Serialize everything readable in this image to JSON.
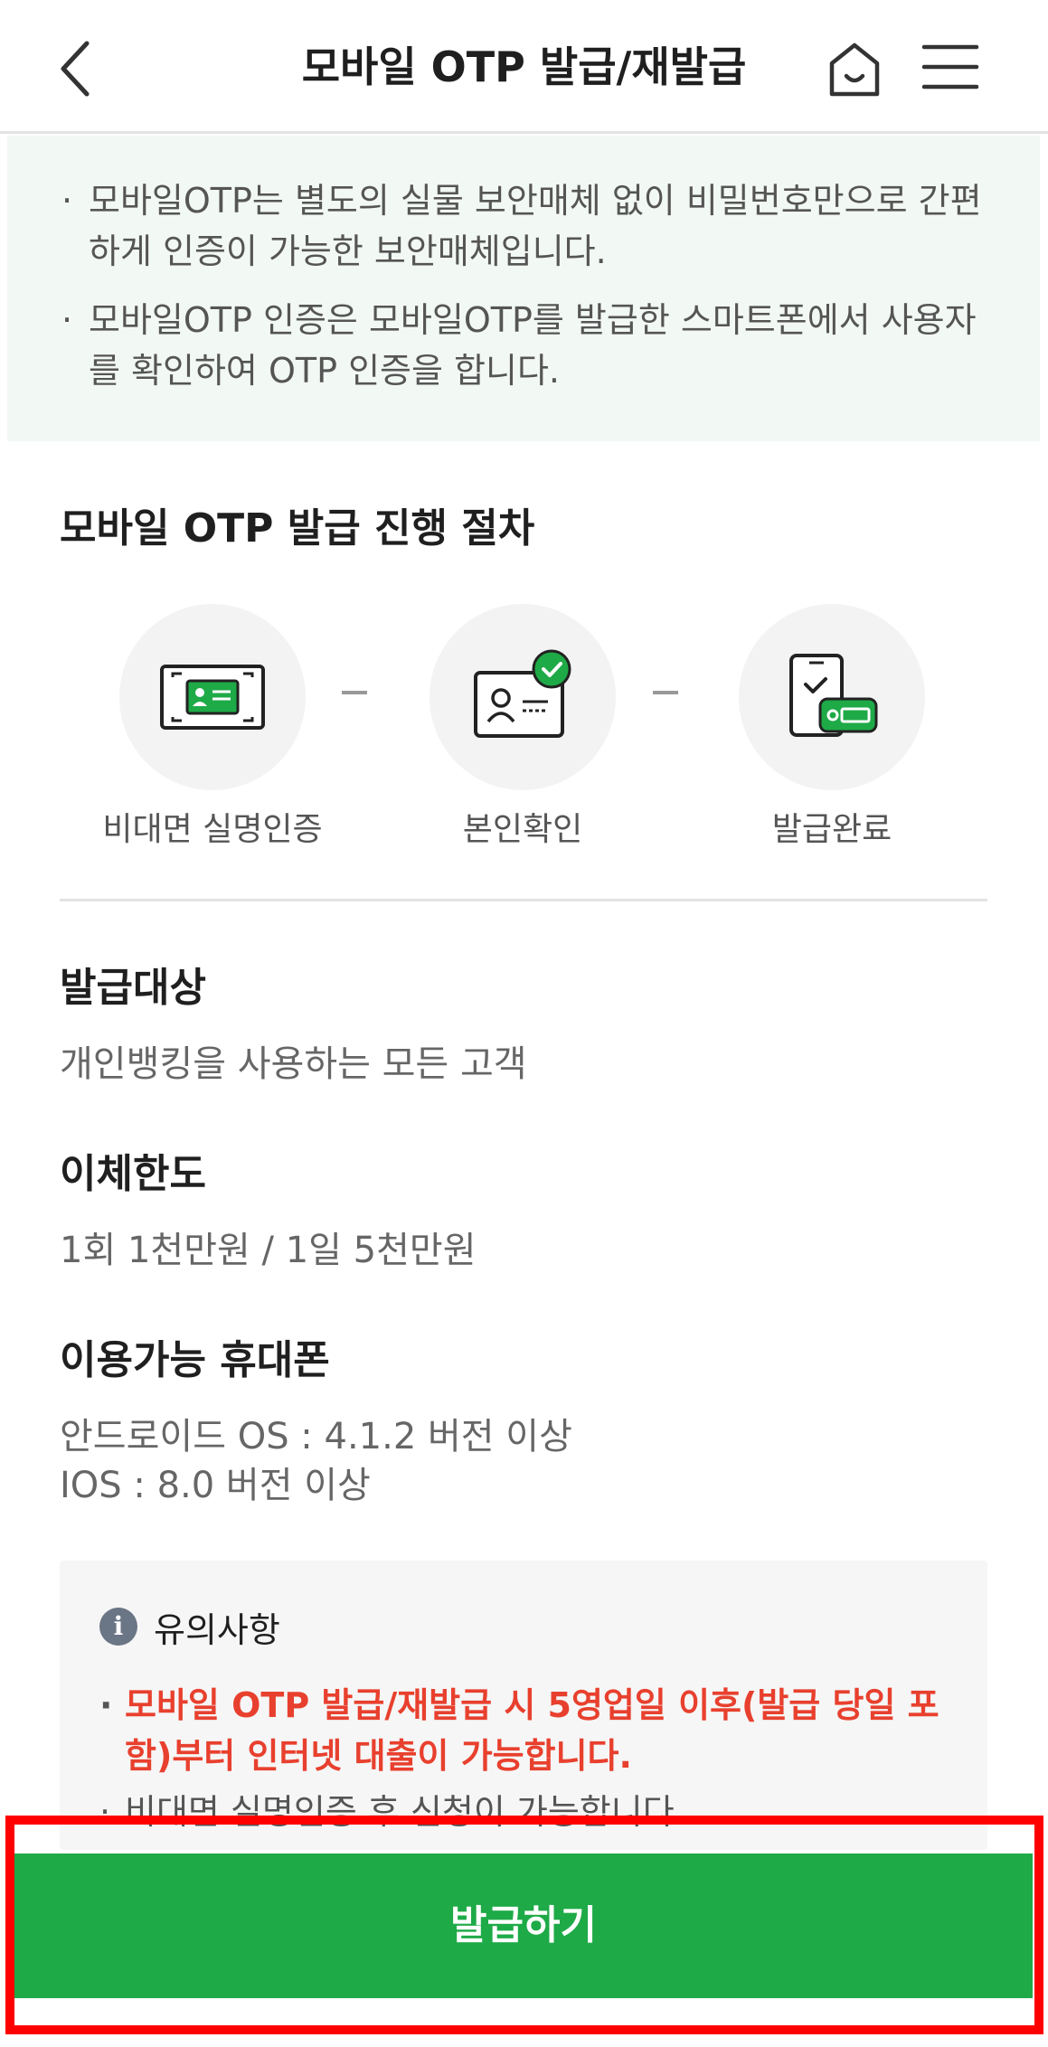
{
  "header": {
    "title": "모바일 OTP 발급/재발급"
  },
  "intro": {
    "items": [
      "모바일OTP는 별도의 실물 보안매체 없이 비밀번호만으로 간편하게 인증이 가능한 보안매체입니다.",
      "모바일OTP 인증은 모바일OTP를 발급한 스마트폰에서 사용자를 확인하여 OTP 인증을 합니다."
    ]
  },
  "procedure": {
    "title": "모바일 OTP 발급 진행 절차",
    "steps": [
      {
        "label": "비대면 실명인증",
        "icon": "id-card-scan-icon"
      },
      {
        "label": "본인확인",
        "icon": "identity-verified-icon"
      },
      {
        "label": "발급완료",
        "icon": "phone-otp-icon"
      }
    ]
  },
  "target": {
    "title": "발급대상",
    "value": "개인뱅킹을 사용하는 모든 고객"
  },
  "limit": {
    "title": "이체한도",
    "value": "1회 1천만원 / 1일 5천만원"
  },
  "phones": {
    "title": "이용가능 휴대폰",
    "android": "안드로이드 OS : 4.1.2 버전 이상",
    "ios": "IOS : 8.0 버전 이상"
  },
  "notice": {
    "title": "유의사항",
    "items": [
      "모바일 OTP 발급/재발급 시 5영업일 이후(발급 당일 포함)부터 인터넷 대출이 가능합니다.",
      "비대면 실명인증 후 신청이 가능합니다."
    ]
  },
  "actions": {
    "issue_label": "발급하기"
  },
  "colors": {
    "brand_green": "#1eaa47",
    "warning_red": "#e8402e",
    "highlight_red": "#ff0000"
  }
}
